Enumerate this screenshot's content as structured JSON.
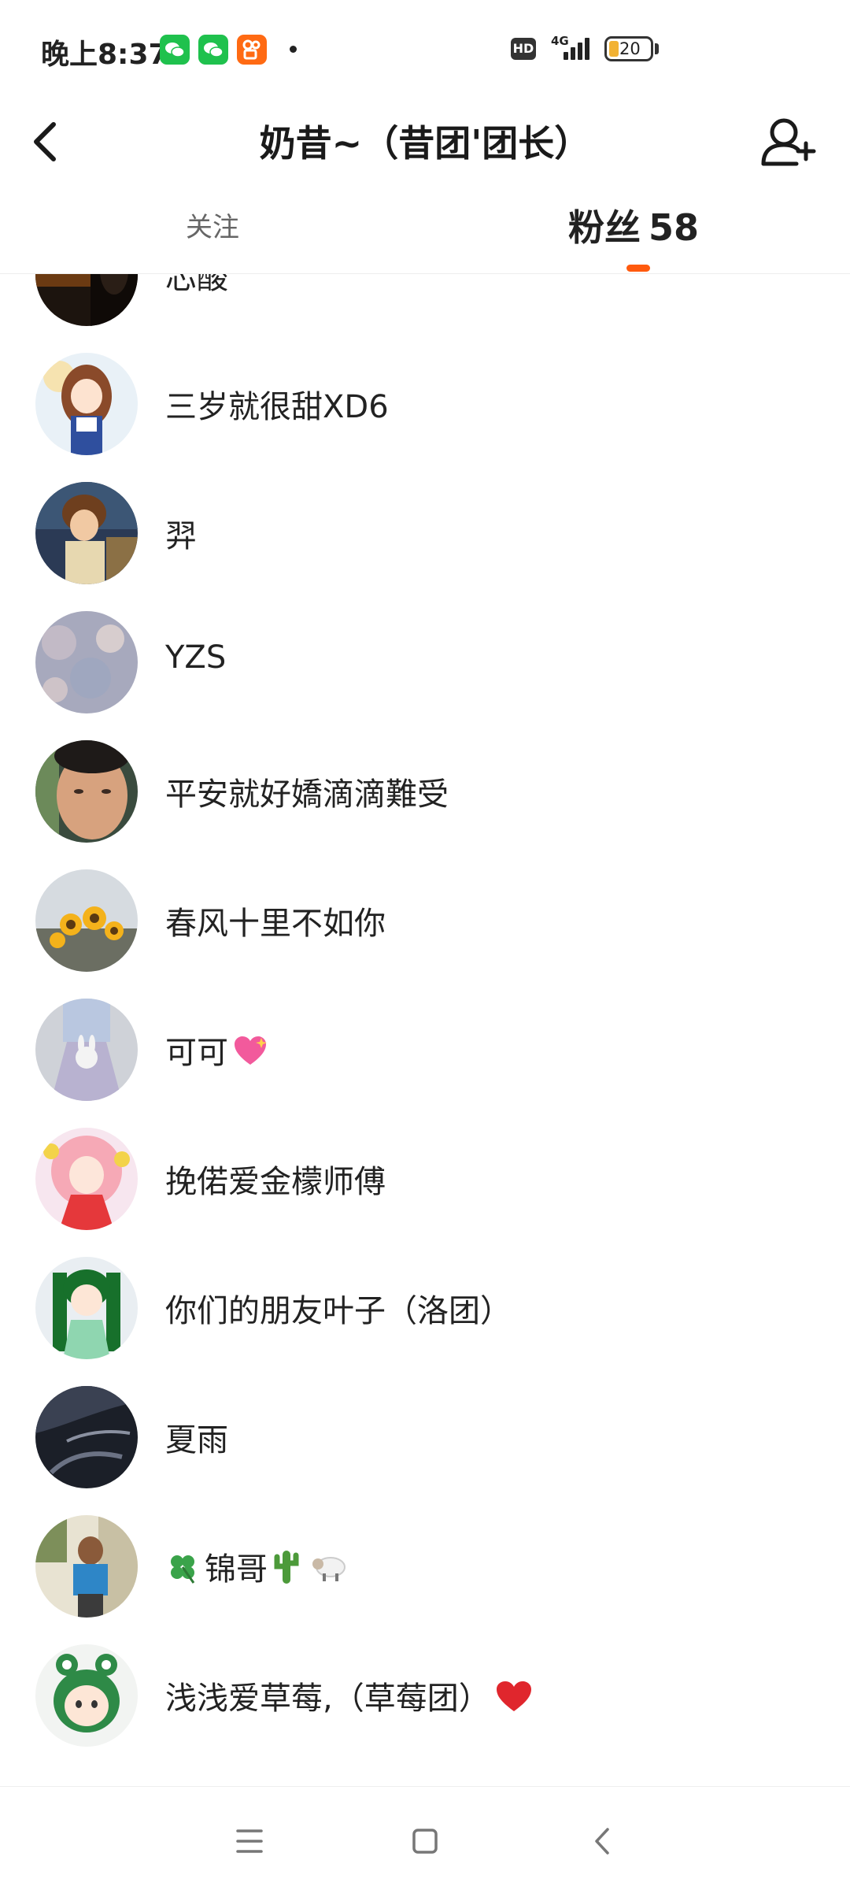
{
  "status_bar": {
    "time": "晚上8:37",
    "hd_label": "HD",
    "network": "4G",
    "battery_level": "20",
    "app_icons": [
      "wechat-icon",
      "wechat-icon",
      "kuaishou-icon"
    ]
  },
  "header": {
    "title": "奶昔~（昔团'团长）",
    "back_icon": "chevron-left-icon",
    "action_icon": "add-user-icon"
  },
  "tabs": {
    "follow_label": "关注",
    "fans_label": "粉丝",
    "fans_count": "58",
    "active": "fans",
    "accent_color": "#ff5a0e"
  },
  "followers": [
    {
      "name": "芯酸"
    },
    {
      "name": "三岁就很甜XD6"
    },
    {
      "name": "羿"
    },
    {
      "name": "YZS"
    },
    {
      "name": "平安就好嬌滴滴難受"
    },
    {
      "name": "春风十里不如你"
    },
    {
      "name": "可可",
      "emoji": "sparkling-heart-icon"
    },
    {
      "name": "挽偌爱金檬师傅"
    },
    {
      "name": "你们的朋友叶子（洛团）"
    },
    {
      "name": "夏雨"
    },
    {
      "name": "锦哥",
      "emoji_before": "four-leaf-clover-icon",
      "emoji_after": [
        "cactus-icon",
        "sheep-icon"
      ]
    },
    {
      "name": "浅浅爱草莓,（草莓团）",
      "emoji": "red-heart-icon"
    }
  ],
  "nav_bar": {
    "icons": [
      "menu-icon",
      "home-square-icon",
      "back-triangle-icon"
    ]
  }
}
